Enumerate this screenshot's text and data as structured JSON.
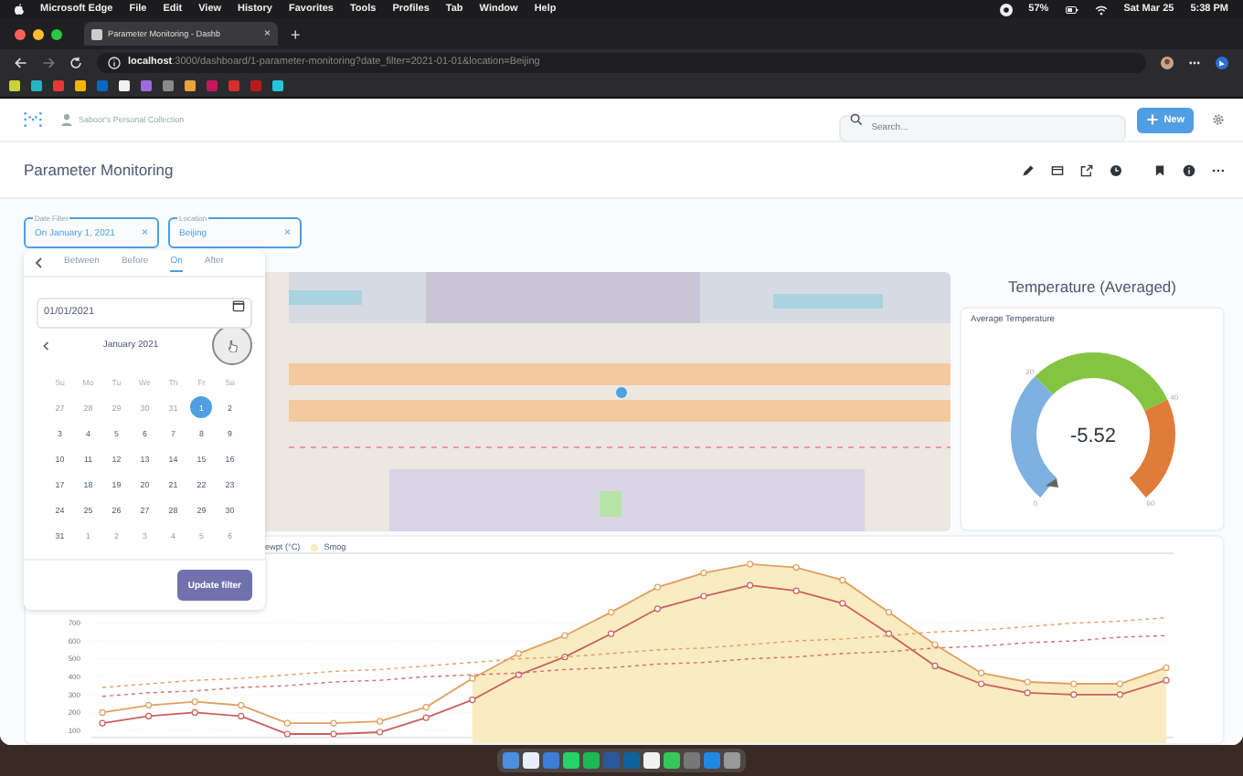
{
  "menu_bar": {
    "app_name": "Microsoft Edge",
    "items": [
      "File",
      "Edit",
      "View",
      "History",
      "Favorites",
      "Tools",
      "Profiles",
      "Tab",
      "Window",
      "Help"
    ],
    "battery": "57%",
    "date": "Sat Mar 25",
    "time": "5:38 PM"
  },
  "browser": {
    "tab_title": "Parameter Monitoring - Dashb",
    "tab_close": "×",
    "new_tab": "+",
    "url_host": "localhost",
    "url_rest": ":3000/dashboard/1-parameter-monitoring?date_filter=2021-01-01&location=Beijing"
  },
  "app_header": {
    "collection": "Saboor's Personal Collection",
    "search": {
      "placeholder": "Search..."
    },
    "new_button": "New"
  },
  "dashboard": {
    "title": "Parameter Monitoring"
  },
  "filters": [
    {
      "label": "Date Filter",
      "value": "On January 1, 2021",
      "clear": "×"
    },
    {
      "label": "Location",
      "value": "Beijing",
      "clear": "×"
    }
  ],
  "date_popup": {
    "tabs": [
      {
        "label": "Between",
        "selected": false
      },
      {
        "label": "Before",
        "selected": false
      },
      {
        "label": "On",
        "selected": true
      },
      {
        "label": "After",
        "selected": false
      }
    ],
    "date_value": "01/01/2021",
    "month": "January 2021",
    "weekdays": [
      "Su",
      "Mo",
      "Tu",
      "We",
      "Th",
      "Fr",
      "Sa"
    ],
    "weeks": [
      [
        {
          "day": "27",
          "outside_month": true,
          "selected": false
        },
        {
          "day": "28",
          "outside_month": true,
          "selected": false
        },
        {
          "day": "29",
          "outside_month": true,
          "selected": false
        },
        {
          "day": "30",
          "outside_month": true,
          "selected": false
        },
        {
          "day": "31",
          "outside_month": true,
          "selected": false
        },
        {
          "day": "1",
          "outside_month": false,
          "selected": true
        },
        {
          "day": "2",
          "outside_month": false,
          "selected": false
        }
      ],
      [
        {
          "day": "3",
          "outside_month": false,
          "selected": false
        },
        {
          "day": "4",
          "outside_month": false,
          "selected": false
        },
        {
          "day": "5",
          "outside_month": false,
          "selected": false
        },
        {
          "day": "6",
          "outside_month": false,
          "selected": false
        },
        {
          "day": "7",
          "outside_month": false,
          "selected": false
        },
        {
          "day": "8",
          "outside_month": false,
          "selected": false
        },
        {
          "day": "9",
          "outside_month": false,
          "selected": false
        }
      ],
      [
        {
          "day": "10",
          "outside_month": false,
          "selected": false
        },
        {
          "day": "11",
          "outside_month": false,
          "selected": false
        },
        {
          "day": "12",
          "outside_month": false,
          "selected": false
        },
        {
          "day": "13",
          "outside_month": false,
          "selected": false
        },
        {
          "day": "14",
          "outside_month": false,
          "selected": false
        },
        {
          "day": "15",
          "outside_month": false,
          "selected": false
        },
        {
          "day": "16",
          "outside_month": false,
          "selected": false
        }
      ],
      [
        {
          "day": "17",
          "outside_month": false,
          "selected": false
        },
        {
          "day": "18",
          "outside_month": false,
          "selected": false
        },
        {
          "day": "19",
          "outside_month": false,
          "selected": false
        },
        {
          "day": "20",
          "outside_month": false,
          "selected": false
        },
        {
          "day": "21",
          "outside_month": false,
          "selected": false
        },
        {
          "day": "22",
          "outside_month": false,
          "selected": false
        },
        {
          "day": "23",
          "outside_month": false,
          "selected": false
        }
      ],
      [
        {
          "day": "24",
          "outside_month": false,
          "selected": false
        },
        {
          "day": "25",
          "outside_month": false,
          "selected": false
        },
        {
          "day": "26",
          "outside_month": false,
          "selected": false
        },
        {
          "day": "27",
          "outside_month": false,
          "selected": false
        },
        {
          "day": "28",
          "outside_month": false,
          "selected": false
        },
        {
          "day": "29",
          "outside_month": false,
          "selected": false
        },
        {
          "day": "30",
          "outside_month": false,
          "selected": false
        }
      ],
      [
        {
          "day": "31",
          "outside_month": false,
          "selected": false
        },
        {
          "day": "1",
          "outside_month": true,
          "selected": false
        },
        {
          "day": "2",
          "outside_month": true,
          "selected": false
        },
        {
          "day": "3",
          "outside_month": true,
          "selected": false
        },
        {
          "day": "4",
          "outside_month": true,
          "selected": false
        },
        {
          "day": "5",
          "outside_month": true,
          "selected": false
        },
        {
          "day": "6",
          "outside_month": true,
          "selected": false
        }
      ]
    ],
    "button": "Update filter"
  },
  "gauge_card": {
    "heading": "Temperature (Averaged)",
    "title": "Average Temperature",
    "value": "-5.52",
    "ticks": [
      "0",
      "20",
      "40",
      "60"
    ]
  },
  "chart": {
    "chart_data": {
      "type": "line",
      "ylim": [
        60,
        1090
      ],
      "grid": true,
      "yticks": [
        100,
        200,
        300,
        400,
        500,
        600,
        700
      ],
      "series": [
        {
          "name": "ewpt (°C)",
          "color": "#c96060",
          "marker": "circle",
          "values": [
            140,
            180,
            200,
            180,
            80,
            80,
            90,
            170,
            270,
            410,
            510,
            640,
            780,
            850,
            910,
            880,
            810,
            640,
            460,
            360,
            310,
            300,
            300,
            380
          ]
        },
        {
          "name": "Smog",
          "type": "area",
          "color": "#f9ebc2",
          "values": [
            null,
            null,
            null,
            null,
            null,
            null,
            null,
            null,
            390,
            530,
            630,
            760,
            900,
            980,
            1030,
            1010,
            940,
            760,
            580,
            420,
            370,
            360,
            360,
            450
          ]
        },
        {
          "color": "#e0a060",
          "marker": "circle",
          "values": [
            200,
            240,
            260,
            240,
            140,
            140,
            150,
            230,
            390,
            530,
            630,
            760,
            900,
            980,
            1030,
            1010,
            940,
            760,
            580,
            420,
            370,
            360,
            360,
            450
          ]
        },
        {
          "color": "#e0a060",
          "line_style": "dashed",
          "values": [
            340,
            360,
            380,
            390,
            410,
            430,
            440,
            460,
            480,
            500,
            510,
            530,
            550,
            560,
            580,
            600,
            610,
            630,
            650,
            660,
            680,
            700,
            710,
            730
          ]
        },
        {
          "color": "#d07070",
          "line_style": "dashed",
          "values": [
            290,
            310,
            320,
            340,
            350,
            370,
            380,
            400,
            410,
            420,
            440,
            450,
            470,
            480,
            500,
            510,
            530,
            540,
            560,
            570,
            590,
            600,
            620,
            630
          ]
        }
      ]
    }
  }
}
